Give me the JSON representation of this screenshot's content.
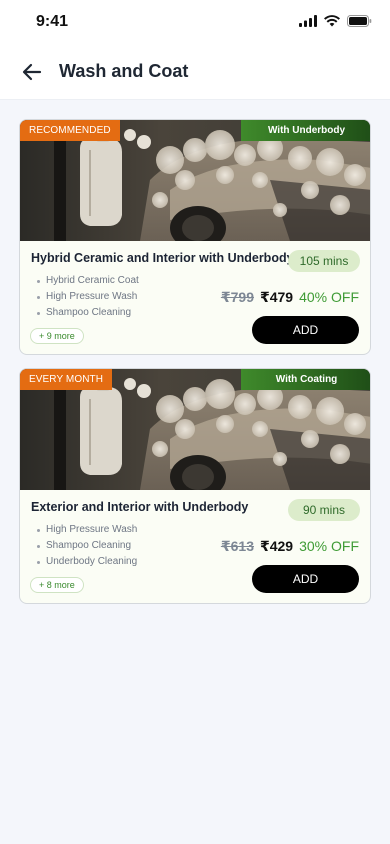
{
  "status_bar": {
    "time": "9:41"
  },
  "header": {
    "title": "Wash and Coat"
  },
  "packages": [
    {
      "badge_left": "RECOMMENDED",
      "badge_right": "With Underbody",
      "title": "Hybrid Ceramic and Interior with Underbody",
      "duration": "105 mins",
      "features": [
        "Hybrid Ceramic Coat",
        "High Pressure Wash",
        "Shampoo Cleaning"
      ],
      "more": "+ 9 more",
      "price_old": "₹799",
      "price_new": "₹479",
      "discount": "40% OFF",
      "add_label": "ADD"
    },
    {
      "badge_left": "EVERY MONTH",
      "badge_right": "With Coating",
      "title": "Exterior and Interior with Underbody",
      "duration": "90 mins",
      "features": [
        "High Pressure Wash",
        "Shampoo Cleaning",
        "Underbody Cleaning"
      ],
      "more": "+ 8 more",
      "price_old": "₹613",
      "price_new": "₹429",
      "discount": "30% OFF",
      "add_label": "ADD"
    }
  ],
  "colors": {
    "recommended_badge": "#e46c12",
    "tag_green": "#2f6a2a",
    "discount_green": "#3f9b35",
    "add_button": "#000000"
  },
  "icons": {
    "back": "back-arrow-icon",
    "signal": "signal-icon",
    "wifi": "wifi-icon",
    "battery": "battery-icon"
  }
}
